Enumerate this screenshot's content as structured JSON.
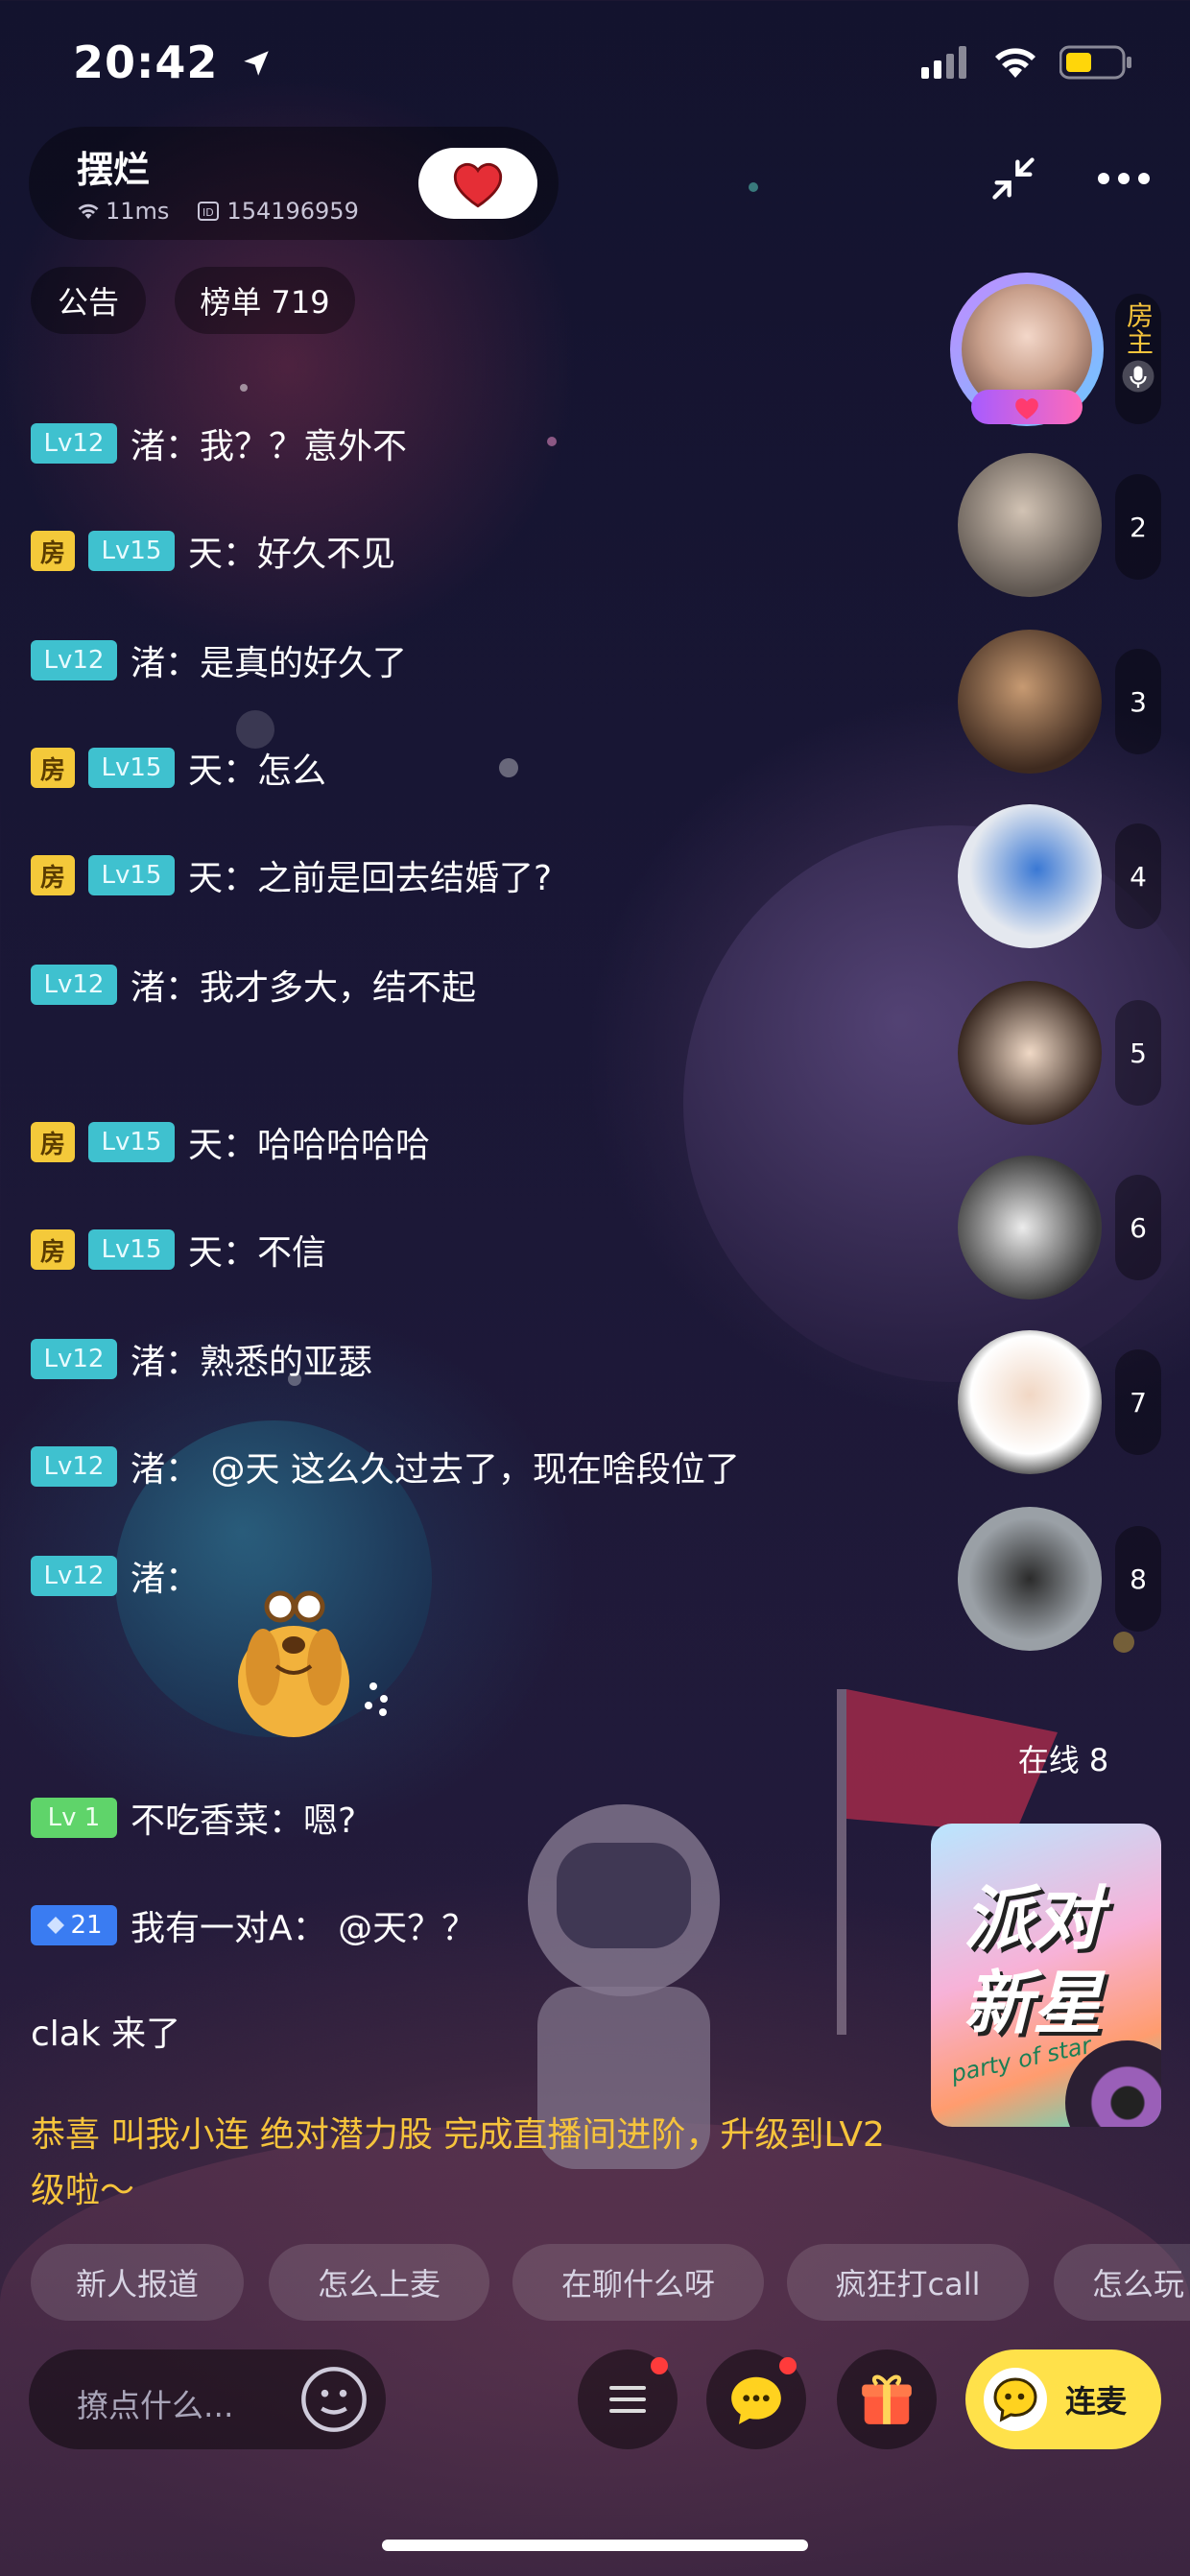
{
  "status_bar": {
    "time": "20:42"
  },
  "room": {
    "name": "摆烂",
    "latency": "11ms",
    "room_id": "154196959"
  },
  "chips": {
    "announcement": "公告",
    "rank": "榜单 719"
  },
  "messages": [
    {
      "badges": [
        "Lv12"
      ],
      "text": "渚：我？？意外不"
    },
    {
      "badges": [
        "房",
        "Lv15"
      ],
      "text": "天：好久不见"
    },
    {
      "badges": [
        "Lv12"
      ],
      "text": "渚：是真的好久了"
    },
    {
      "badges": [
        "房",
        "Lv15"
      ],
      "text": "天：怎么"
    },
    {
      "badges": [
        "房",
        "Lv15"
      ],
      "text": "天：之前是回去结婚了?"
    },
    {
      "badges": [
        "Lv12"
      ],
      "text": "渚：我才多大，结不起"
    },
    {
      "badges": [
        "房",
        "Lv15"
      ],
      "text": "天：哈哈哈哈哈"
    },
    {
      "badges": [
        "房",
        "Lv15"
      ],
      "text": "天：不信"
    },
    {
      "badges": [
        "Lv12"
      ],
      "text": "渚：熟悉的亚瑟"
    },
    {
      "badges": [
        "Lv12"
      ],
      "text": "渚：  @天 这么久过去了，现在啥段位了"
    },
    {
      "badges": [
        "Lv12"
      ],
      "text": "渚："
    },
    {
      "badges": [
        "Lv 1"
      ],
      "text": "不吃香菜：嗯?"
    },
    {
      "badges": [
        "21"
      ],
      "text": "我有一对A：  @天？？"
    }
  ],
  "system_messages": {
    "join": "clak 来了",
    "congrats": "恭喜  叫我小连  绝对潜力股 完成直播间进阶，升级到LV2级啦～"
  },
  "seats": {
    "host_label": "房主",
    "numbers": [
      "2",
      "3",
      "4",
      "5",
      "6",
      "7",
      "8"
    ]
  },
  "online": "在线 8",
  "promo": {
    "title_line1": "派对",
    "title_line2": "新星",
    "subtitle": "party of star"
  },
  "quick_replies": [
    "新人报道",
    "怎么上麦",
    "在聊什么呀",
    "疯狂打call",
    "怎么玩"
  ],
  "input": {
    "placeholder": "撩点什么..."
  },
  "connect_button": "连麦",
  "colors": {
    "accent_yellow": "#ffe14a",
    "level_teal": "#3fc1cf",
    "host_yellow": "#f4c93a",
    "notification_red": "#ff3b3b"
  }
}
